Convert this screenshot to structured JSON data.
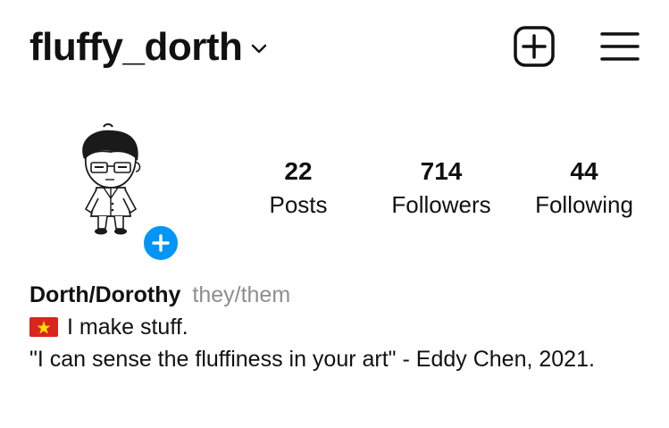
{
  "header": {
    "username": "fluffy_dorth"
  },
  "colors": {
    "accent": "#0095f6",
    "text": "#111111",
    "muted": "#8e8e8e"
  },
  "icons": [
    "chevron-down-icon",
    "plus-square-icon",
    "hamburger-menu-icon",
    "plus-icon",
    "vietnam-flag-icon"
  ],
  "stats": {
    "posts": {
      "value": "22",
      "label": "Posts"
    },
    "followers": {
      "value": "714",
      "label": "Followers"
    },
    "following": {
      "value": "44",
      "label": "Following"
    }
  },
  "bio": {
    "name": "Dorth/Dorothy",
    "pronouns": "they/them",
    "line1": "I make stuff.",
    "line2": "\"I can sense the fluffiness in your art\" - Eddy Chen, 2021."
  }
}
